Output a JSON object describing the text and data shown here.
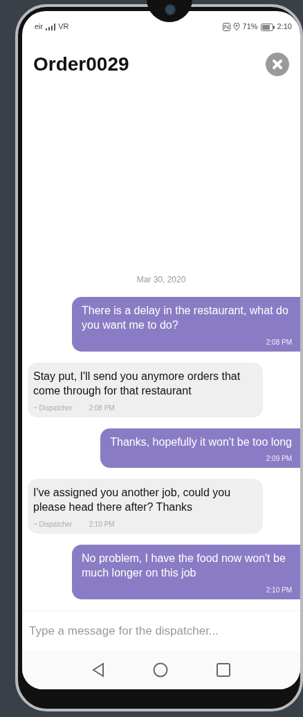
{
  "status_bar": {
    "carrier": "eir",
    "network": "VR",
    "battery_percent": "71%",
    "time": "2:10"
  },
  "header": {
    "title": "Order0029"
  },
  "date_separator": "Mar 30, 2020",
  "messages": [
    {
      "kind": "sent",
      "text": "There is a delay in the restaurant, what do you want me to do?",
      "time": "2:08 PM"
    },
    {
      "kind": "received",
      "text": "Stay put, I'll send you anymore orders that come through for that restaurant",
      "sender": "~ Dispatcher",
      "time": "2:08 PM"
    },
    {
      "kind": "sent",
      "text": "Thanks, hopefully it won't be too long",
      "time": "2:09 PM"
    },
    {
      "kind": "received",
      "text": "I've assigned you another job, could you please head there after? Thanks",
      "sender": "~ Dispatcher",
      "time": "2:10 PM"
    },
    {
      "kind": "sent",
      "text": "No problem, I have the food now won't be much longer on this job",
      "time": "2:10 PM"
    }
  ],
  "composer": {
    "placeholder": "Type a message for the dispatcher..."
  }
}
